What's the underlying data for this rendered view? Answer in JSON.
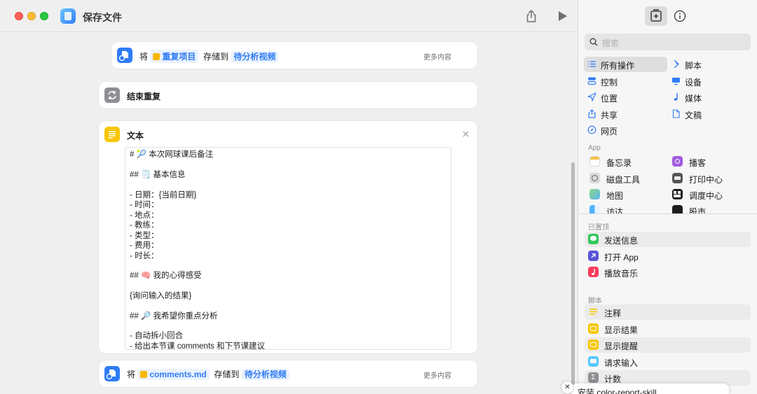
{
  "window": {
    "title": "保存文件"
  },
  "save_step_1": {
    "prefix": "将",
    "variable": "重复项目",
    "middle": "存储到",
    "destination": "待分析视频",
    "more": "更多内容"
  },
  "end_repeat": {
    "label": "结束重复"
  },
  "text_action": {
    "title": "文本",
    "lines": [
      "# 🎾 本次网球课后备注",
      "",
      "## 🗒️ 基本信息",
      "",
      "- 日期：{当前日期}",
      "- 时间：",
      "- 地点：",
      "- 教练：",
      "- 类型：",
      "- 费用：",
      "- 时长：",
      "",
      "## 🧠 我的心得感受",
      "",
      "{询问输入的结果}",
      "",
      "## 🔎 我希望你重点分析",
      "",
      "- 自动拆小回合",
      "- 给出本节课 comments 和下节课建议"
    ]
  },
  "save_step_2": {
    "prefix": "将",
    "variable": "comments.md",
    "middle": "存储到",
    "destination": "待分析视频",
    "more": "更多内容"
  },
  "sidebar": {
    "search_placeholder": "搜索",
    "categories_left": [
      "所有操作",
      "控制",
      "位置",
      "共享",
      "网页"
    ],
    "categories_right": [
      "脚本",
      "设备",
      "媒体",
      "文稿"
    ],
    "app_heading": "App",
    "apps_left": [
      "备忘录",
      "磁盘工具",
      "地图",
      "访达"
    ],
    "apps_right": [
      "播客",
      "打印中心",
      "调度中心",
      "股市"
    ],
    "pinned_heading": "已置顶",
    "pinned": [
      "发送信息",
      "打开 App",
      "播放音乐"
    ],
    "script_heading": "脚本",
    "scripts": [
      "注释",
      "显示结果",
      "显示提醒",
      "请求输入",
      "计数"
    ]
  },
  "toast": {
    "text": "安装 color-report-skill",
    "close": "✕"
  },
  "colors": {
    "accent": "#2f7cf6",
    "close_red": "#ff5f57",
    "minimize_yellow": "#febc2e",
    "zoom_green": "#28c840"
  }
}
